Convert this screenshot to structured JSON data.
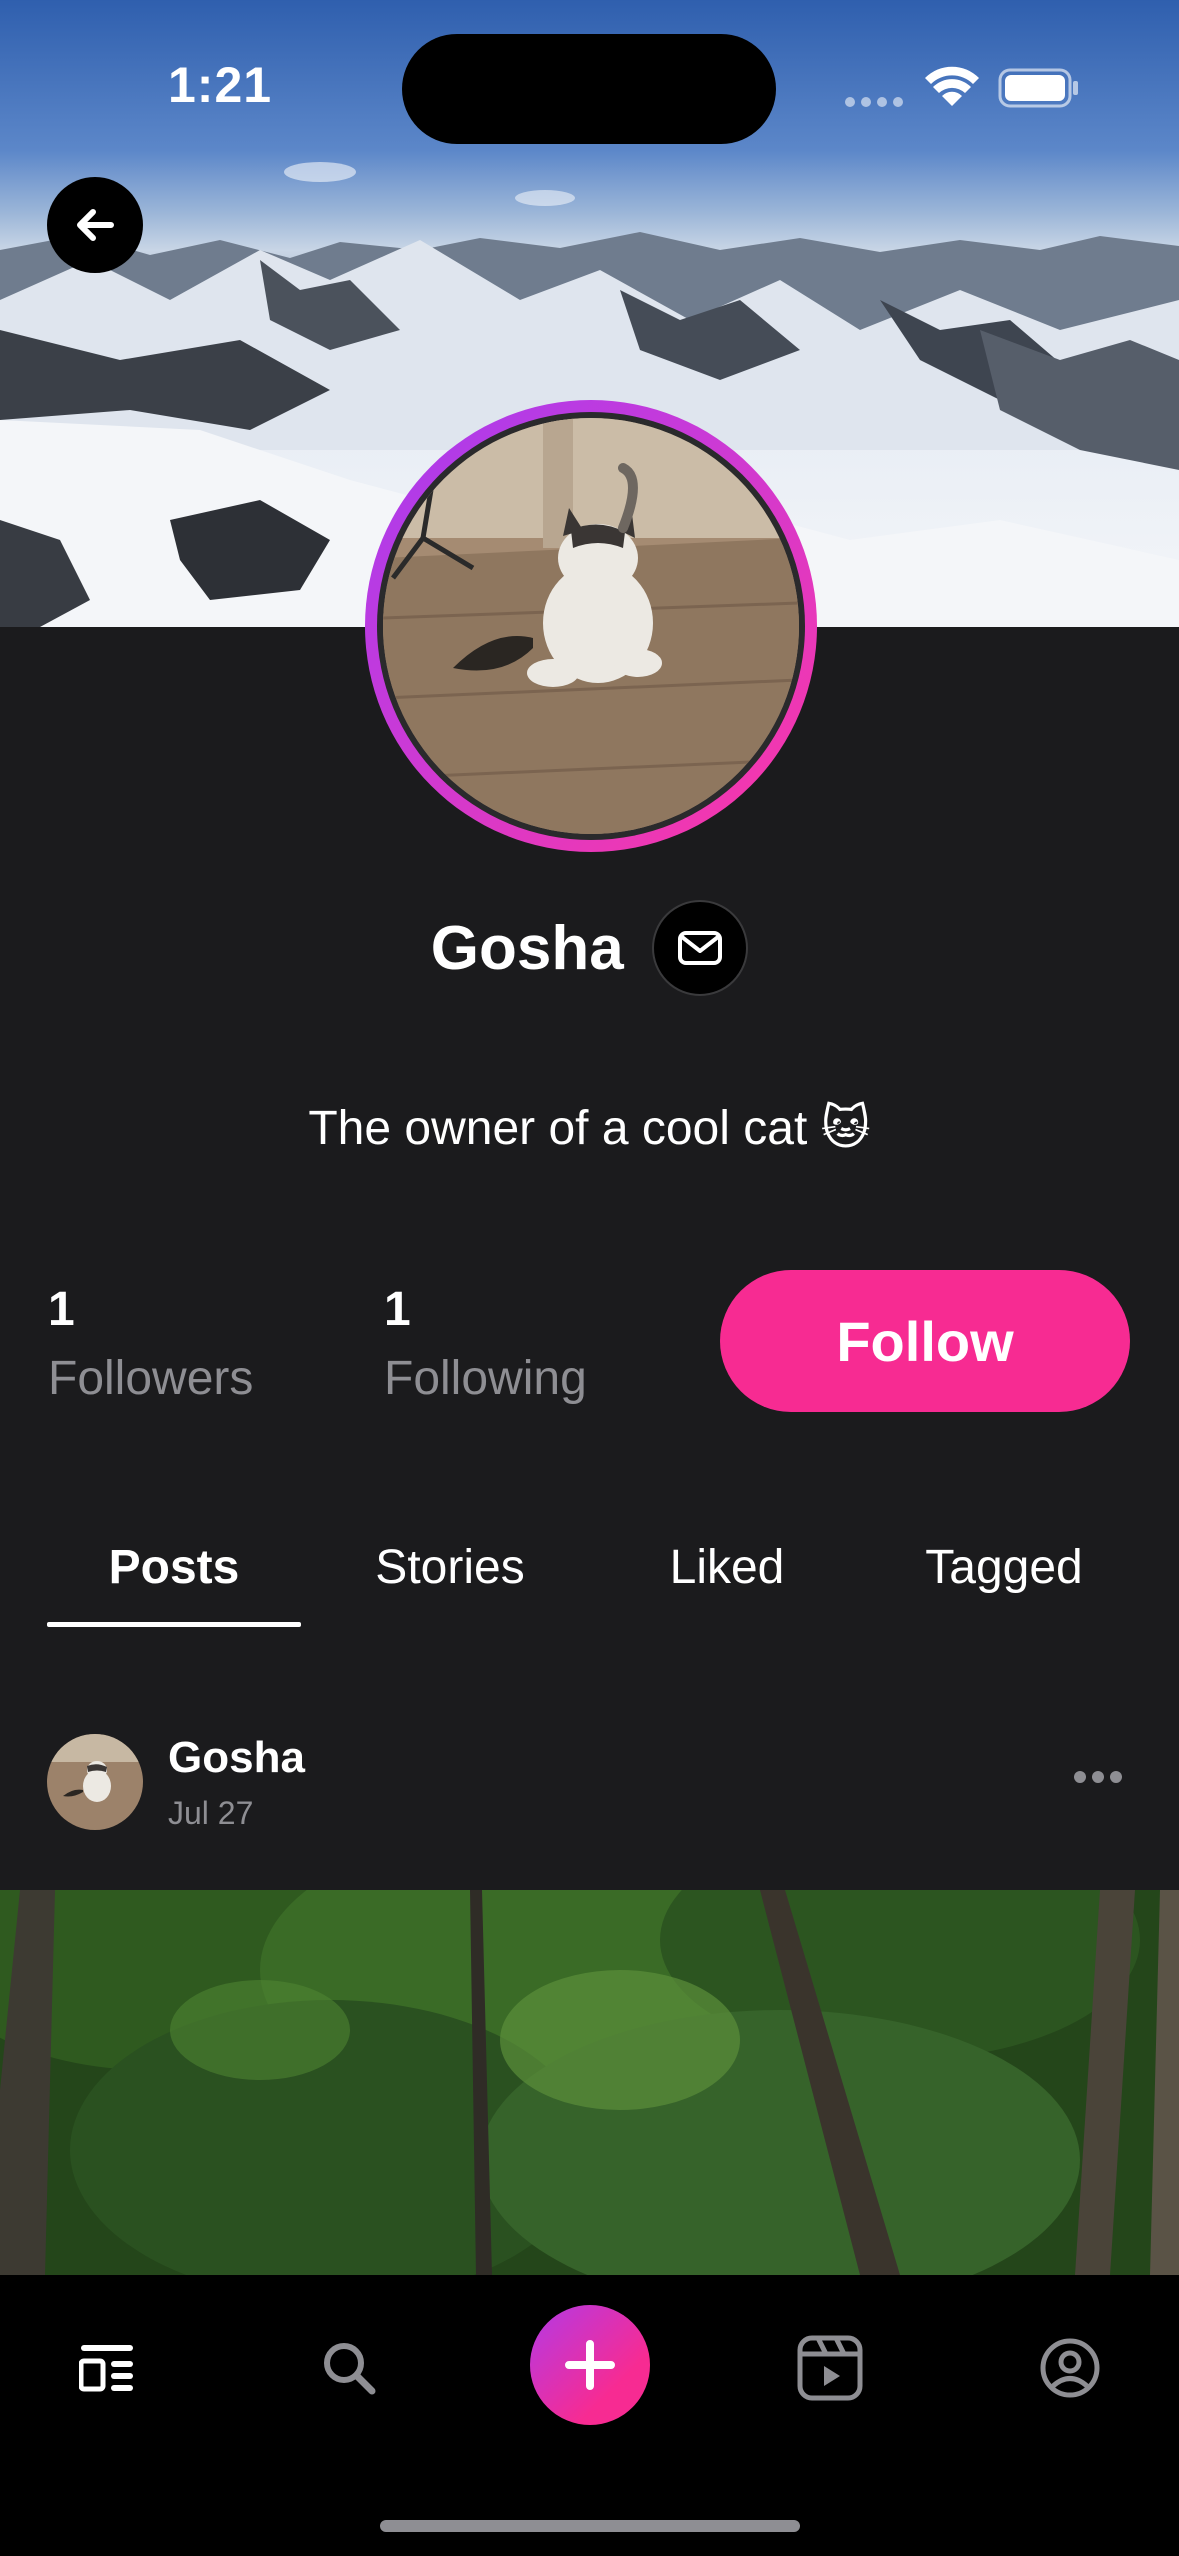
{
  "status_bar": {
    "time": "1:21"
  },
  "profile": {
    "name": "Gosha",
    "bio": "The owner of a cool cat 🐱",
    "stats": [
      {
        "value": "1",
        "label": "Followers"
      },
      {
        "value": "1",
        "label": "Following"
      }
    ],
    "follow_label": "Follow"
  },
  "tabs": [
    {
      "label": "Posts",
      "active": true
    },
    {
      "label": "Stories",
      "active": false
    },
    {
      "label": "Liked",
      "active": false
    },
    {
      "label": "Tagged",
      "active": false
    }
  ],
  "post": {
    "author": "Gosha",
    "date": "Jul 27"
  },
  "bottom_nav": [
    {
      "icon": "feed-icon"
    },
    {
      "icon": "search-icon"
    },
    {
      "icon": "plus-icon"
    },
    {
      "icon": "reels-icon"
    },
    {
      "icon": "profile-icon"
    }
  ],
  "colors": {
    "accent": "#f72b92",
    "background": "#1b1b1d",
    "muted": "#8e8e93"
  }
}
